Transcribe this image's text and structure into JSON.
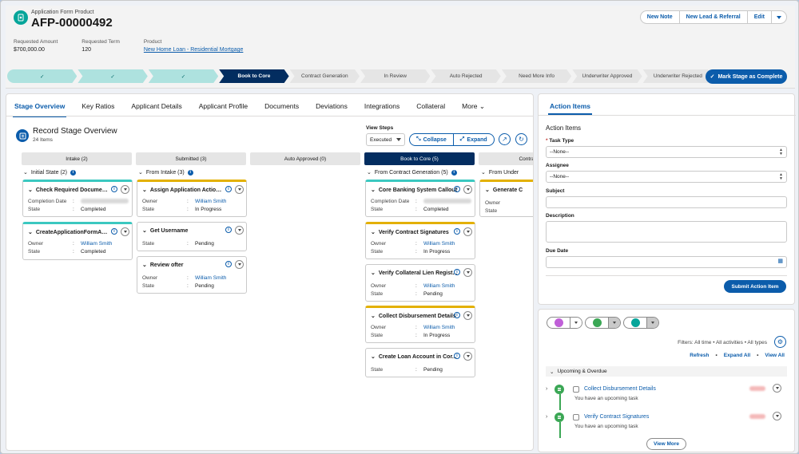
{
  "header": {
    "object_type": "Application Form Product",
    "title": "AFP-00000492",
    "buttons": {
      "new_note": "New Note",
      "new_lead": "New Lead & Referral",
      "edit": "Edit"
    },
    "fields": [
      {
        "label": "Requested Amount",
        "value": "$700,000.00"
      },
      {
        "label": "Requested Term",
        "value": "120"
      },
      {
        "label": "Product",
        "value": "New Home Loan - Residential Mortgage"
      }
    ]
  },
  "path": {
    "steps": [
      "✓",
      "✓",
      "✓",
      "Book to Core",
      "Contract Generation",
      "In Review",
      "Auto Rejected",
      "Need More Info",
      "Underwriter Approved",
      "Underwriter Rejected"
    ],
    "current_index": 3,
    "mark_button": "Mark Stage as Complete"
  },
  "tabs": [
    "Stage Overview",
    "Key Ratios",
    "Applicant Details",
    "Applicant Profile",
    "Documents",
    "Deviations",
    "Integrations",
    "Collateral",
    "More"
  ],
  "overview": {
    "title": "Record Stage Overview",
    "count": "24 Items",
    "view_steps_label": "View Steps",
    "view_steps_value": "Executed",
    "collapse": "Collapse",
    "expand": "Expand"
  },
  "columns": [
    {
      "label": "Intake (2)",
      "group": "Initial State (2)"
    },
    {
      "label": "Submitted (3)",
      "group": "From Intake (3)"
    },
    {
      "label": "Auto Approved (0)",
      "group": ""
    },
    {
      "label": "Book to Core (5)",
      "group": "From Contract Generation (5)"
    },
    {
      "label": "Contra",
      "group": "From Under"
    }
  ],
  "cards": {
    "c1": {
      "title": "Check Required Document...",
      "k1": "Completion Date",
      "k2": "State",
      "v2": "Completed"
    },
    "c2": {
      "title": "CreateApplicationFormApp...",
      "k1": "Owner",
      "v1": "William Smith",
      "k2": "State",
      "v2": "Completed"
    },
    "c3": {
      "title": "Assign Application Action It...",
      "k1": "Owner",
      "v1": "William Smith",
      "k2": "State",
      "v2": "In Progress"
    },
    "c4": {
      "title": "Get Username",
      "k1": "State",
      "v1": "Pending"
    },
    "c5": {
      "title": "Review ofter",
      "k1": "Owner",
      "v1": "William Smith",
      "k2": "State",
      "v2": "Pending"
    },
    "c6": {
      "title": "Core Banking System Callout",
      "k1": "Completion Date",
      "k2": "State",
      "v2": "Completed"
    },
    "c7": {
      "title": "Verify Contract Signatures",
      "k1": "Owner",
      "v1": "William Smith",
      "k2": "State",
      "v2": "In Progress"
    },
    "c8": {
      "title": "Verify Collateral Lien Regist...",
      "k1": "Owner",
      "v1": "William Smith",
      "k2": "State",
      "v2": "Pending"
    },
    "c9": {
      "title": "Collect Disbursement Details",
      "k1": "Owner",
      "v1": "William Smith",
      "k2": "State",
      "v2": "In Progress"
    },
    "c10": {
      "title": "Create Loan Account in Cor...",
      "k1": "State",
      "v1": "Pending"
    },
    "c11": {
      "title": "Generate C",
      "k1": "Owner",
      "k2": "State"
    }
  },
  "action_items": {
    "tab": "Action Items",
    "heading": "Action Items",
    "task_type_label": "Task Type",
    "task_type_value": "--None--",
    "assignee_label": "Assignee",
    "assignee_value": "--None--",
    "subject_label": "Subject",
    "description_label": "Description",
    "due_date_label": "Due Date",
    "submit": "Submit Action Item"
  },
  "activity": {
    "filters": "Filters: All time • All activities • All types",
    "refresh": "Refresh",
    "expand_all": "Expand All",
    "view_all": "View All",
    "upcoming": "Upcoming & Overdue",
    "tasks": [
      {
        "title": "Collect Disbursement Details",
        "sub": "You have an upcoming task"
      },
      {
        "title": "Verify Contract Signatures",
        "sub": "You have an upcoming task"
      }
    ],
    "view_more": "View More"
  },
  "colors": {
    "brand": "#0b5cab",
    "path_current": "#032d60",
    "path_done": "#aee2df",
    "teal": "#06a59a"
  }
}
